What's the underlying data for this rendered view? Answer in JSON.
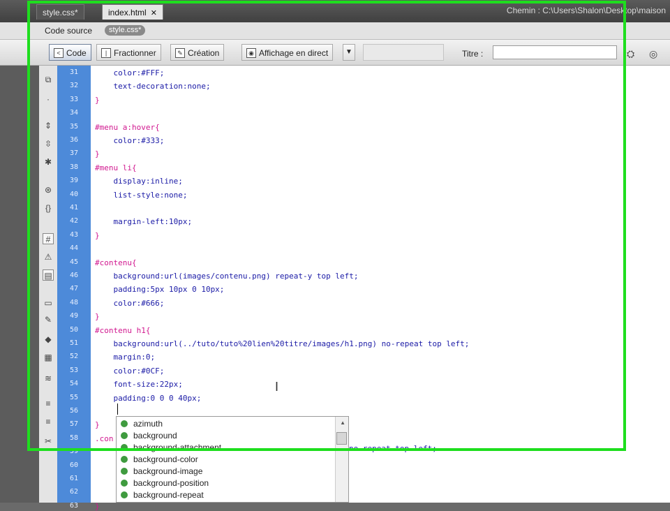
{
  "tabs": [
    {
      "label": "style.css*"
    },
    {
      "label": "index.html",
      "close": "✕"
    }
  ],
  "path": "Chemin : C:\\Users\\Shalon\\Desktop\\maison",
  "related": {
    "label": "Code source",
    "file": "style.css*"
  },
  "toolbar": {
    "code": "Code",
    "split": "Fractionner",
    "design": "Création",
    "live": "Affichage en direct",
    "title_label": "Titre :"
  },
  "code_lines": [
    {
      "n": "31",
      "text": "    color:#FFF;"
    },
    {
      "n": "32",
      "text": "    text-decoration:none;"
    },
    {
      "n": "33",
      "text": "}"
    },
    {
      "n": "34",
      "text": ""
    },
    {
      "n": "35",
      "text": "#menu a:hover{"
    },
    {
      "n": "36",
      "text": "    color:#333;"
    },
    {
      "n": "37",
      "text": "}"
    },
    {
      "n": "38",
      "text": "#menu li{"
    },
    {
      "n": "39",
      "text": "    display:inline;"
    },
    {
      "n": "40",
      "text": "    list-style:none;"
    },
    {
      "n": "41",
      "text": ""
    },
    {
      "n": "42",
      "text": "    margin-left:10px;"
    },
    {
      "n": "43",
      "text": "}"
    },
    {
      "n": "44",
      "text": ""
    },
    {
      "n": "45",
      "text": "#contenu{"
    },
    {
      "n": "46",
      "text": "    background:url(images/contenu.png) repeat-y top left;"
    },
    {
      "n": "47",
      "text": "    padding:5px 10px 0 10px;"
    },
    {
      "n": "48",
      "text": "    color:#666;"
    },
    {
      "n": "49",
      "text": "}"
    },
    {
      "n": "50",
      "text": "#contenu h1{"
    },
    {
      "n": "51",
      "text": "    background:url(../tuto/tuto%20lien%20titre/images/h1.png) no-repeat top left;"
    },
    {
      "n": "52",
      "text": "    margin:0;"
    },
    {
      "n": "53",
      "text": "    color:#0CF;"
    },
    {
      "n": "54",
      "text": "    font-size:22px;"
    },
    {
      "n": "55",
      "text": "    padding:0 0 0 40px;"
    },
    {
      "n": "56",
      "text": ""
    },
    {
      "n": "57",
      "text": "}"
    },
    {
      "n": "58",
      "text": ".con"
    },
    {
      "n": "59",
      "text": ""
    },
    {
      "n": "60",
      "text": ""
    },
    {
      "n": "61",
      "text": ""
    },
    {
      "n": "62",
      "text": ""
    },
    {
      "n": "63",
      "text": "}"
    }
  ],
  "autocomplete": [
    "azimuth",
    "background",
    "background-attachment",
    "background-color",
    "background-image",
    "background-position",
    "background-repeat"
  ],
  "overflow_text": "no-repeat top left;",
  "colors": {
    "frame": "#1ede1e",
    "gutter": "#4d8ad9",
    "selector": "#d1178f",
    "property": "#1a1aa6"
  }
}
